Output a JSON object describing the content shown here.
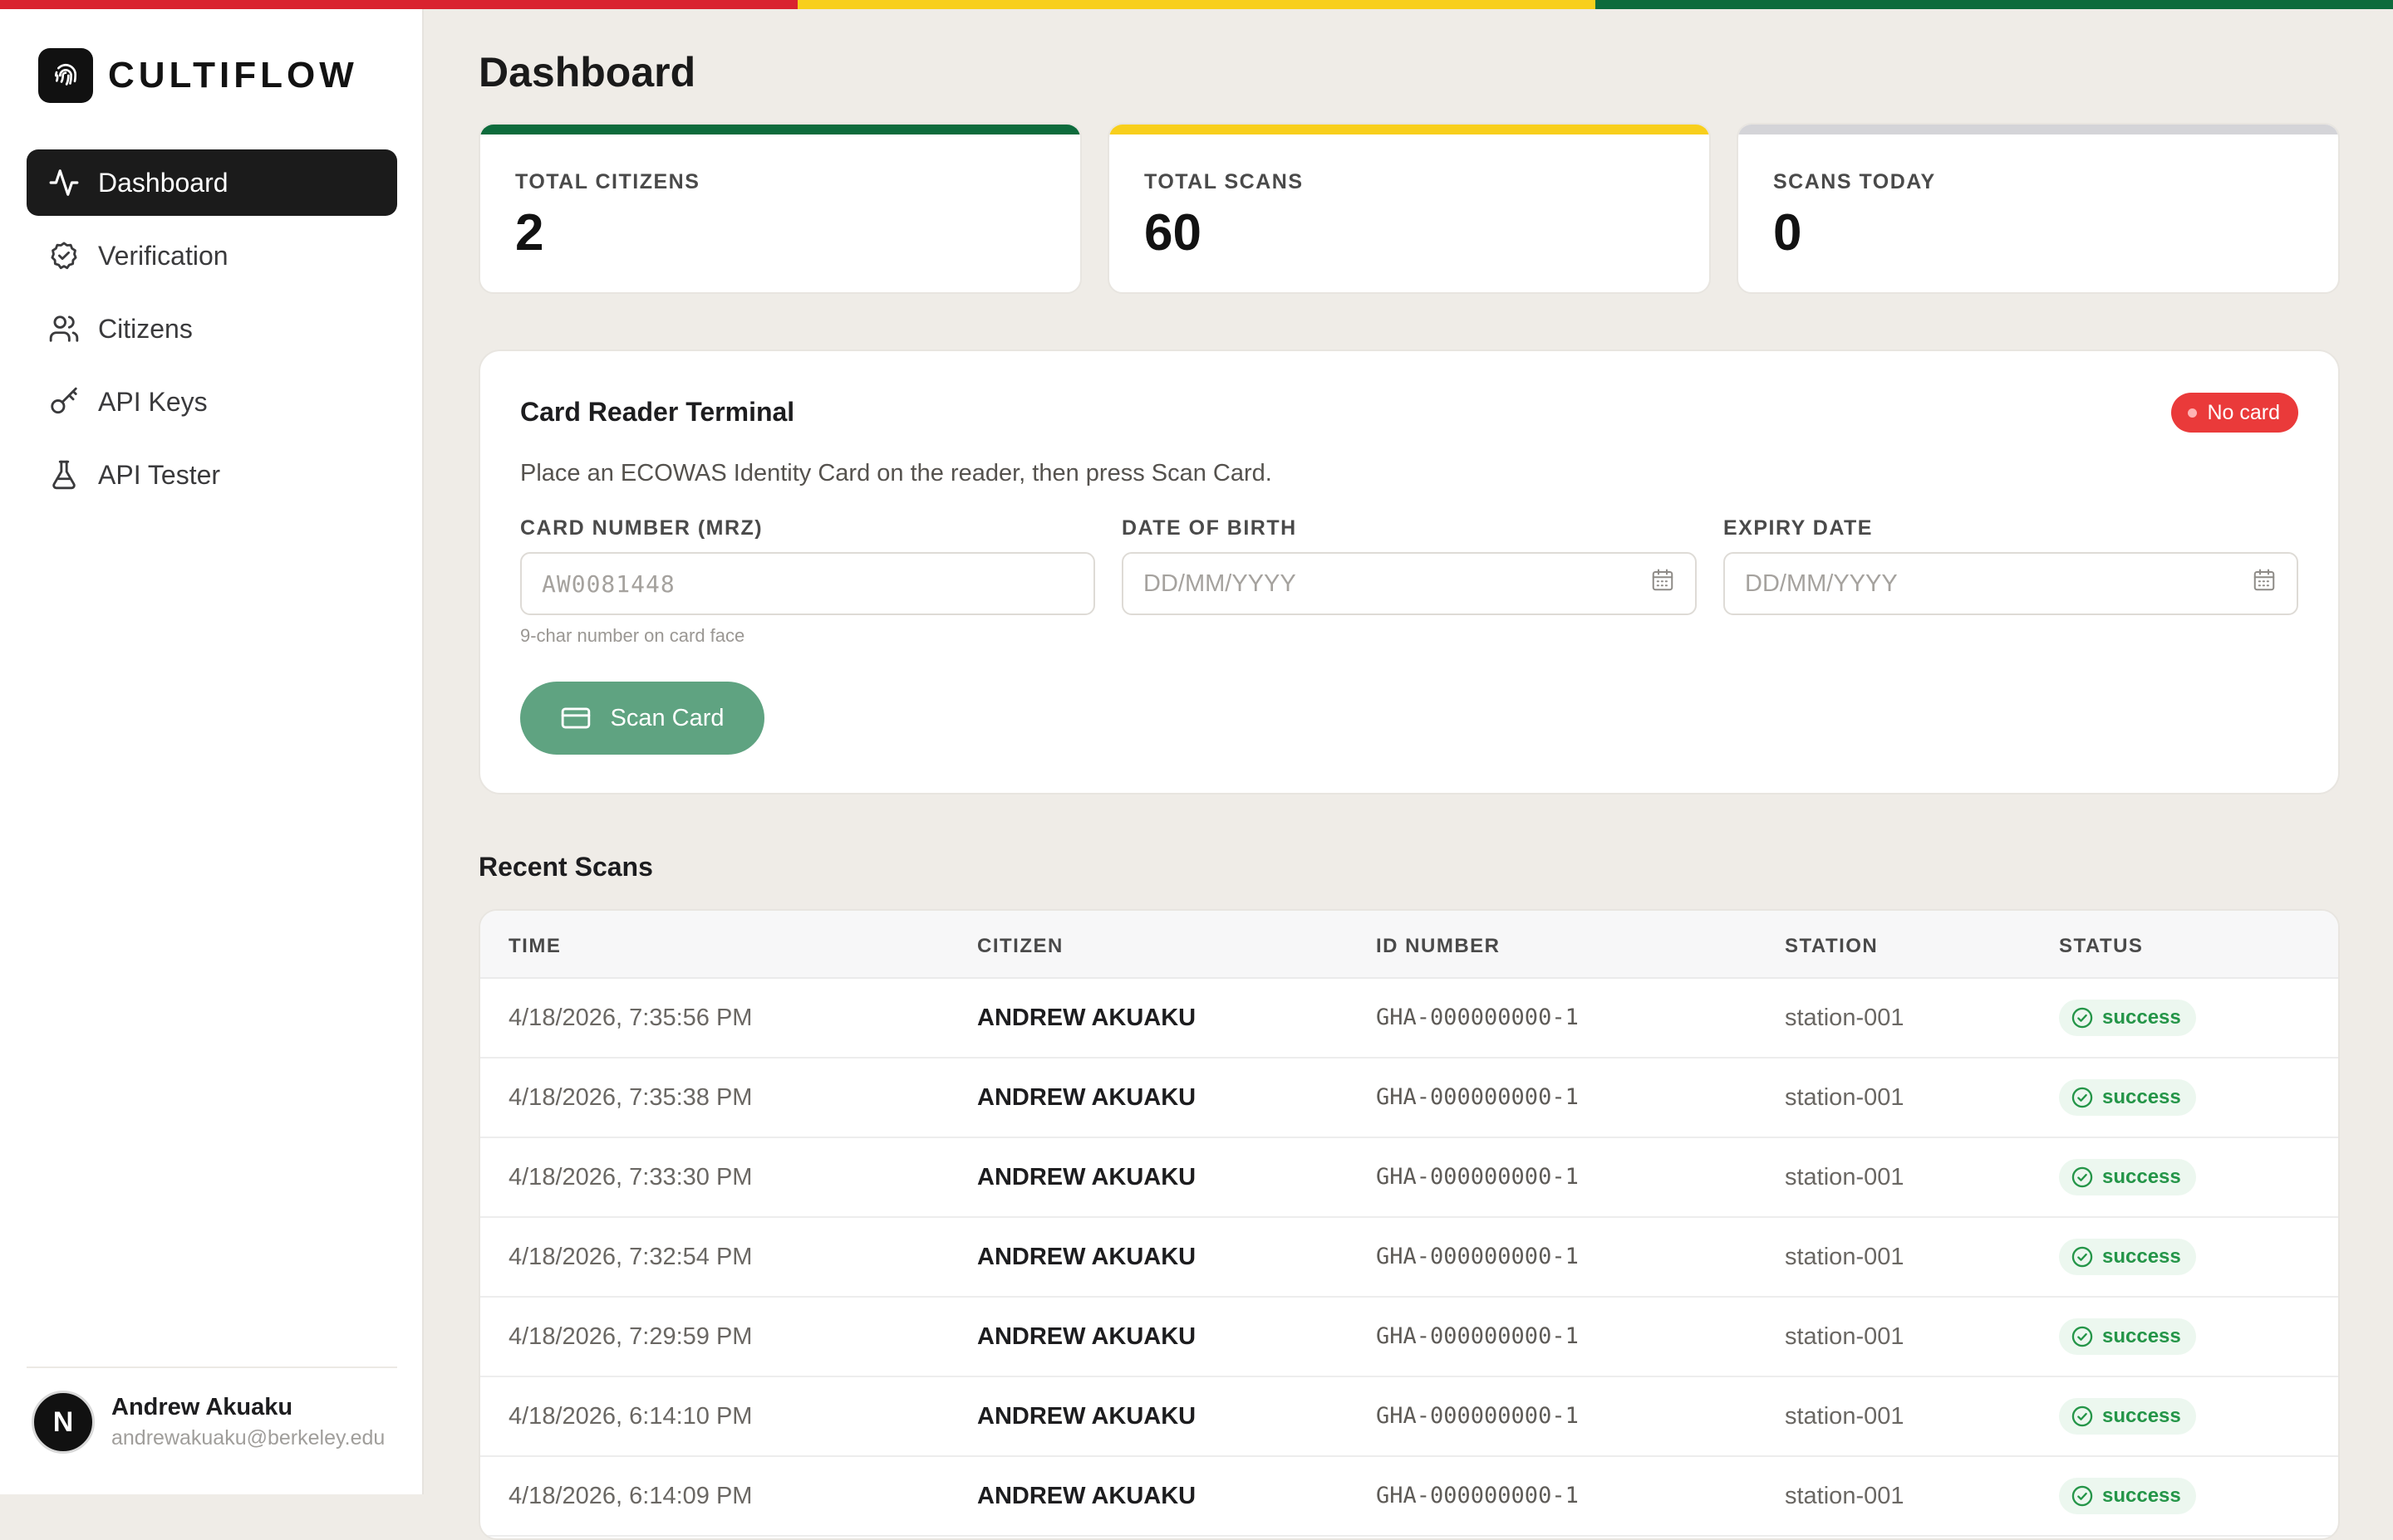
{
  "colors": {
    "flag_red": "#d9232f",
    "flag_yellow": "#f8cf1c",
    "flag_green": "#0d6b3c",
    "accent_green": "#5fa381",
    "badge_red": "#ea3a3a"
  },
  "brand": {
    "name": "CULTIFLOW",
    "logo_icon": "fingerprint-icon"
  },
  "sidebar": {
    "items": [
      {
        "label": "Dashboard",
        "icon": "activity-icon",
        "active": true
      },
      {
        "label": "Verification",
        "icon": "badge-check-icon",
        "active": false
      },
      {
        "label": "Citizens",
        "icon": "users-icon",
        "active": false
      },
      {
        "label": "API Keys",
        "icon": "key-icon",
        "active": false
      },
      {
        "label": "API Tester",
        "icon": "flask-icon",
        "active": false
      }
    ]
  },
  "user": {
    "initial": "N",
    "name": "Andrew Akuaku",
    "email": "andrewakuaku@berkeley.edu"
  },
  "page": {
    "title": "Dashboard"
  },
  "stats": [
    {
      "label": "TOTAL CITIZENS",
      "value": "2",
      "accent": "#0d6b3c"
    },
    {
      "label": "TOTAL SCANS",
      "value": "60",
      "accent": "#f8cf1c"
    },
    {
      "label": "SCANS TODAY",
      "value": "0",
      "accent": "#d4d4d8"
    }
  ],
  "terminal": {
    "title": "Card Reader Terminal",
    "status_badge": "No card",
    "description": "Place an ECOWAS Identity Card on the reader, then press Scan Card.",
    "fields": {
      "card_number": {
        "label": "CARD NUMBER (MRZ)",
        "placeholder": "AW0081448",
        "hint": "9-char number on card face"
      },
      "date_of_birth": {
        "label": "DATE OF BIRTH",
        "placeholder": "DD/MM/YYYY"
      },
      "expiry_date": {
        "label": "EXPIRY DATE",
        "placeholder": "DD/MM/YYYY"
      }
    },
    "scan_button": "Scan Card"
  },
  "recent_scans": {
    "title": "Recent Scans",
    "columns": [
      "TIME",
      "CITIZEN",
      "ID NUMBER",
      "STATION",
      "STATUS"
    ],
    "rows": [
      {
        "time": "4/18/2026, 7:35:56 PM",
        "citizen": "ANDREW AKUAKU",
        "id_number": "GHA-000000000-1",
        "station": "station-001",
        "status": "success"
      },
      {
        "time": "4/18/2026, 7:35:38 PM",
        "citizen": "ANDREW AKUAKU",
        "id_number": "GHA-000000000-1",
        "station": "station-001",
        "status": "success"
      },
      {
        "time": "4/18/2026, 7:33:30 PM",
        "citizen": "ANDREW AKUAKU",
        "id_number": "GHA-000000000-1",
        "station": "station-001",
        "status": "success"
      },
      {
        "time": "4/18/2026, 7:32:54 PM",
        "citizen": "ANDREW AKUAKU",
        "id_number": "GHA-000000000-1",
        "station": "station-001",
        "status": "success"
      },
      {
        "time": "4/18/2026, 7:29:59 PM",
        "citizen": "ANDREW AKUAKU",
        "id_number": "GHA-000000000-1",
        "station": "station-001",
        "status": "success"
      },
      {
        "time": "4/18/2026, 6:14:10 PM",
        "citizen": "ANDREW AKUAKU",
        "id_number": "GHA-000000000-1",
        "station": "station-001",
        "status": "success"
      },
      {
        "time": "4/18/2026, 6:14:09 PM",
        "citizen": "ANDREW AKUAKU",
        "id_number": "GHA-000000000-1",
        "station": "station-001",
        "status": "success"
      }
    ]
  }
}
